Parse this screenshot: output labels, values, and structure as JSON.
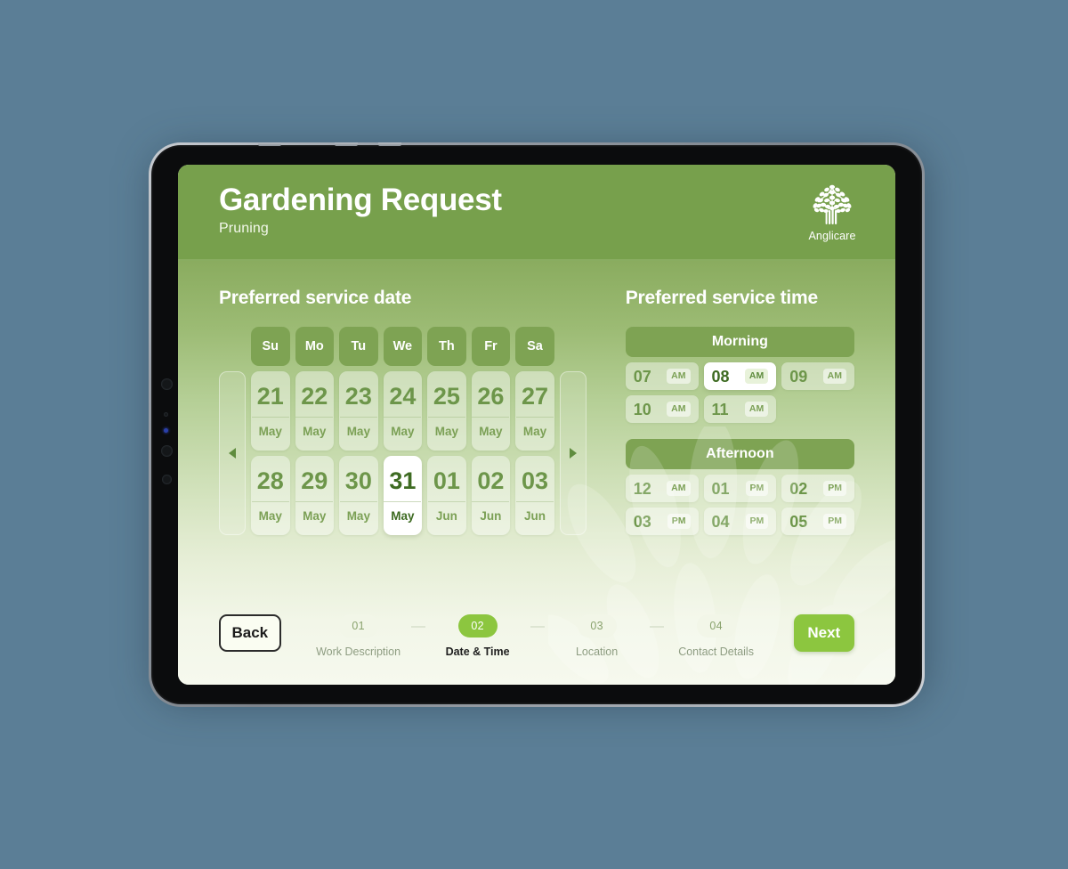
{
  "header": {
    "title": "Gardening Request",
    "subtitle": "Pruning",
    "logo_name": "Anglicare",
    "logo_icon": "tree-icon",
    "bg_color": "#77a04c"
  },
  "date_section": {
    "title": "Preferred service date",
    "prev_icon": "chevron-left-icon",
    "next_icon": "chevron-right-icon",
    "weekdays": [
      "Su",
      "Mo",
      "Tu",
      "We",
      "Th",
      "Fr",
      "Sa"
    ],
    "days": [
      {
        "num": "21",
        "mon": "May",
        "selected": false
      },
      {
        "num": "22",
        "mon": "May",
        "selected": false
      },
      {
        "num": "23",
        "mon": "May",
        "selected": false
      },
      {
        "num": "24",
        "mon": "May",
        "selected": false
      },
      {
        "num": "25",
        "mon": "May",
        "selected": false
      },
      {
        "num": "26",
        "mon": "May",
        "selected": false
      },
      {
        "num": "27",
        "mon": "May",
        "selected": false
      },
      {
        "num": "28",
        "mon": "May",
        "selected": false
      },
      {
        "num": "29",
        "mon": "May",
        "selected": false
      },
      {
        "num": "30",
        "mon": "May",
        "selected": false
      },
      {
        "num": "31",
        "mon": "May",
        "selected": true
      },
      {
        "num": "01",
        "mon": "Jun",
        "selected": false
      },
      {
        "num": "02",
        "mon": "Jun",
        "selected": false
      },
      {
        "num": "03",
        "mon": "Jun",
        "selected": false
      }
    ],
    "selected_date": "31 May"
  },
  "time_section": {
    "title": "Preferred service time",
    "groups": [
      {
        "label": "Morning",
        "slots": [
          {
            "hour": "07",
            "meridiem": "AM",
            "selected": false
          },
          {
            "hour": "08",
            "meridiem": "AM",
            "selected": true
          },
          {
            "hour": "09",
            "meridiem": "AM",
            "selected": false
          },
          {
            "hour": "10",
            "meridiem": "AM",
            "selected": false
          },
          {
            "hour": "11",
            "meridiem": "AM",
            "selected": false
          }
        ]
      },
      {
        "label": "Afternoon",
        "slots": [
          {
            "hour": "12",
            "meridiem": "AM",
            "selected": false
          },
          {
            "hour": "01",
            "meridiem": "PM",
            "selected": false
          },
          {
            "hour": "02",
            "meridiem": "PM",
            "selected": false
          },
          {
            "hour": "03",
            "meridiem": "PM",
            "selected": false
          },
          {
            "hour": "04",
            "meridiem": "PM",
            "selected": false
          },
          {
            "hour": "05",
            "meridiem": "PM",
            "selected": false
          }
        ]
      }
    ],
    "selected_time": "08 AM"
  },
  "footer": {
    "back_label": "Back",
    "next_label": "Next",
    "accent_color": "#8cc63f",
    "steps": [
      {
        "num": "01",
        "label": "Work Description",
        "active": false
      },
      {
        "num": "02",
        "label": "Date & Time",
        "active": true
      },
      {
        "num": "03",
        "label": "Location",
        "active": false
      },
      {
        "num": "04",
        "label": "Contact Details",
        "active": false
      }
    ]
  }
}
